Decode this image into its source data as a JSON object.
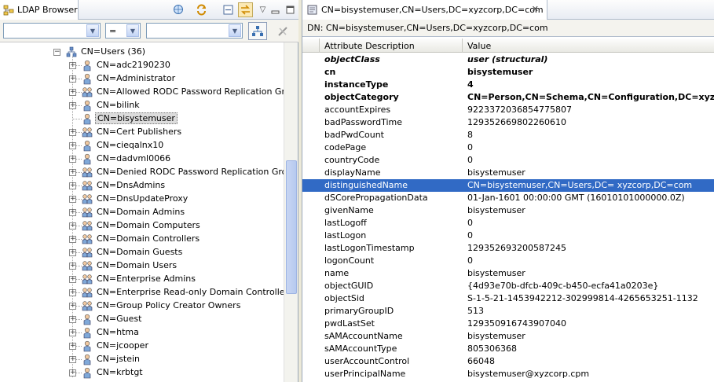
{
  "left_panel": {
    "tab_title": "LDAP Browser",
    "filter": {
      "attribute_value": "",
      "operator_value": "=",
      "filter_value": ""
    },
    "tree": {
      "root": {
        "label": "CN=Users (36)",
        "expanded": true
      },
      "items": [
        {
          "label": "CN=adc2190230",
          "icon": "user-icon"
        },
        {
          "label": "CN=Administrator",
          "icon": "user-icon"
        },
        {
          "label": "CN=Allowed RODC Password Replication Group",
          "icon": "group-icon"
        },
        {
          "label": "CN=bilink",
          "icon": "user-icon"
        },
        {
          "label": "CN=bisystemuser",
          "icon": "user-icon",
          "selected": true
        },
        {
          "label": "CN=Cert Publishers",
          "icon": "group-icon"
        },
        {
          "label": "CN=cieqalnx10",
          "icon": "user-icon"
        },
        {
          "label": "CN=dadvml0066",
          "icon": "user-icon"
        },
        {
          "label": "CN=Denied RODC Password Replication Group",
          "icon": "group-icon"
        },
        {
          "label": "CN=DnsAdmins",
          "icon": "group-icon"
        },
        {
          "label": "CN=DnsUpdateProxy",
          "icon": "group-icon"
        },
        {
          "label": "CN=Domain Admins",
          "icon": "group-icon"
        },
        {
          "label": "CN=Domain Computers",
          "icon": "group-icon"
        },
        {
          "label": "CN=Domain Controllers",
          "icon": "group-icon"
        },
        {
          "label": "CN=Domain Guests",
          "icon": "group-icon"
        },
        {
          "label": "CN=Domain Users",
          "icon": "group-icon"
        },
        {
          "label": "CN=Enterprise Admins",
          "icon": "group-icon"
        },
        {
          "label": "CN=Enterprise Read-only Domain Controllers",
          "icon": "group-icon"
        },
        {
          "label": "CN=Group Policy Creator Owners",
          "icon": "group-icon"
        },
        {
          "label": "CN=Guest",
          "icon": "user-icon"
        },
        {
          "label": "CN=htma",
          "icon": "user-icon"
        },
        {
          "label": "CN=jcooper",
          "icon": "user-icon"
        },
        {
          "label": "CN=jstein",
          "icon": "user-icon"
        },
        {
          "label": "CN=krbtgt",
          "icon": "user-icon"
        }
      ]
    }
  },
  "right_panel": {
    "tab_title": "CN=bisystemuser,CN=Users,DC=xyzcorp,DC=com",
    "dn_text": "DN: CN=bisystemuser,CN=Users,DC=xyzcorp,DC=com",
    "columns": {
      "attribute": "Attribute Description",
      "value": "Value"
    },
    "rows": [
      {
        "attr": "objectClass",
        "value": "user (structural)",
        "style": "bi"
      },
      {
        "attr": "cn",
        "value": "bisystemuser",
        "style": "b"
      },
      {
        "attr": "instanceType",
        "value": "4",
        "style": "b"
      },
      {
        "attr": "objectCategory",
        "value": "CN=Person,CN=Schema,CN=Configuration,DC=xyzcorp",
        "style": "b"
      },
      {
        "attr": "accountExpires",
        "value": "9223372036854775807"
      },
      {
        "attr": "badPasswordTime",
        "value": "129352669802260610"
      },
      {
        "attr": "badPwdCount",
        "value": "8"
      },
      {
        "attr": "codePage",
        "value": "0"
      },
      {
        "attr": "countryCode",
        "value": "0"
      },
      {
        "attr": "displayName",
        "value": "bisystemuser"
      },
      {
        "attr": "distinguishedName",
        "value": "CN=bisystemuser,CN=Users,DC= xyzcorp,DC=com",
        "selected": true
      },
      {
        "attr": "dSCorePropagationData",
        "value": "01-Jan-1601 00:00:00 GMT (16010101000000.0Z)"
      },
      {
        "attr": "givenName",
        "value": "bisystemuser"
      },
      {
        "attr": "lastLogoff",
        "value": "0"
      },
      {
        "attr": "lastLogon",
        "value": "0"
      },
      {
        "attr": "lastLogonTimestamp",
        "value": "129352693200587245"
      },
      {
        "attr": "logonCount",
        "value": "0"
      },
      {
        "attr": "name",
        "value": "bisystemuser"
      },
      {
        "attr": "objectGUID",
        "value": "{4d93e70b-dfcb-409c-b450-ecfa41a0203e}"
      },
      {
        "attr": "objectSid",
        "value": "S-1-5-21-1453942212-302999814-4265653251-1132"
      },
      {
        "attr": "primaryGroupID",
        "value": "513"
      },
      {
        "attr": "pwdLastSet",
        "value": "129350916743907040"
      },
      {
        "attr": "sAMAccountName",
        "value": "bisystemuser"
      },
      {
        "attr": "sAMAccountType",
        "value": "805306368"
      },
      {
        "attr": "userAccountControl",
        "value": "66048"
      },
      {
        "attr": "userPrincipalName",
        "value": "bisystemuser@xyzcorp.cpm"
      }
    ]
  },
  "colors": {
    "selection_blue": "#316ac5",
    "tree_selection": "#dcdcdc",
    "pane_border": "#9aa7b8"
  }
}
